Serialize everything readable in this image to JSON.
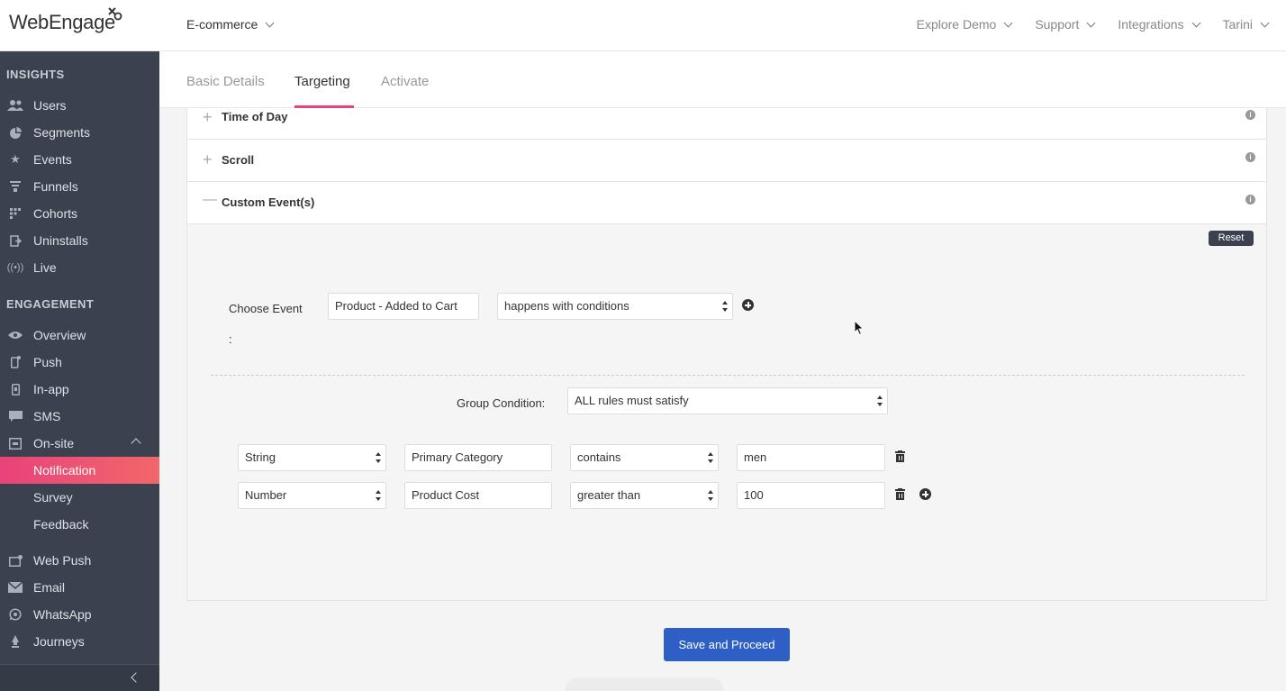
{
  "header": {
    "logo_text": "WebEngage",
    "project": "E-commerce",
    "nav": [
      "Explore Demo",
      "Support",
      "Integrations",
      "Tarini"
    ]
  },
  "sidebar": {
    "insights_title": "INSIGHTS",
    "insights": [
      {
        "label": "Users",
        "icon": "users-icon"
      },
      {
        "label": "Segments",
        "icon": "pie-icon"
      },
      {
        "label": "Events",
        "icon": "events-icon"
      },
      {
        "label": "Funnels",
        "icon": "funnel-icon"
      },
      {
        "label": "Cohorts",
        "icon": "grid-icon"
      },
      {
        "label": "Uninstalls",
        "icon": "uninstall-icon"
      },
      {
        "label": "Live",
        "icon": "live-icon"
      }
    ],
    "engagement_title": "ENGAGEMENT",
    "engagement": [
      {
        "label": "Overview",
        "icon": "eye-icon"
      },
      {
        "label": "Push",
        "icon": "push-icon"
      },
      {
        "label": "In-app",
        "icon": "inapp-icon"
      },
      {
        "label": "SMS",
        "icon": "sms-icon"
      },
      {
        "label": "On-site",
        "icon": "onsite-icon"
      }
    ],
    "onsite_sub": [
      "Notification",
      "Survey",
      "Feedback"
    ],
    "more": [
      {
        "label": "Web Push",
        "icon": "webpush-icon"
      },
      {
        "label": "Email",
        "icon": "email-icon"
      },
      {
        "label": "WhatsApp",
        "icon": "whatsapp-icon"
      },
      {
        "label": "Journeys",
        "icon": "journeys-icon"
      }
    ]
  },
  "tabs": [
    "Basic Details",
    "Targeting",
    "Activate"
  ],
  "sections": {
    "time_of_day": "Time of Day",
    "scroll": "Scroll",
    "custom_events": "Custom Event(s)"
  },
  "panel": {
    "reset": "Reset",
    "choose_event_label": "Choose Event",
    "colon": ":",
    "event_value": "Product - Added to Cart",
    "event_condition": "happens with conditions",
    "group_condition_label": "Group Condition:",
    "group_condition_value": "ALL rules must satisfy",
    "rules": [
      {
        "type": "String",
        "property": "Primary Category",
        "operator": "contains",
        "value": "men"
      },
      {
        "type": "Number",
        "property": "Product Cost",
        "operator": "greater than",
        "value": "100"
      }
    ]
  },
  "save_button": "Save and Proceed"
}
